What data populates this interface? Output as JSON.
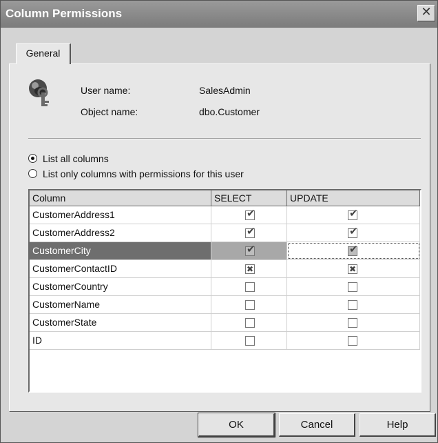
{
  "window": {
    "title": "Column Permissions",
    "close_label": "✕"
  },
  "tabs": [
    {
      "label": "General"
    }
  ],
  "info": {
    "user_name_label": "User name:",
    "user_name_value": "SalesAdmin",
    "object_name_label": "Object name:",
    "object_name_value": "dbo.Customer"
  },
  "options": {
    "list_all": "List all columns",
    "list_only": "List only columns with permissions for this user",
    "selected": "list_all"
  },
  "grid": {
    "columns": [
      "Column",
      "SELECT",
      "UPDATE"
    ],
    "rows": [
      {
        "name": "CustomerAddress1",
        "select": "grant",
        "update": "grant"
      },
      {
        "name": "CustomerAddress2",
        "select": "grant",
        "update": "grant"
      },
      {
        "name": "CustomerCity",
        "select": "grant",
        "update": "grant",
        "selected": true
      },
      {
        "name": "CustomerContactID",
        "select": "deny",
        "update": "deny"
      },
      {
        "name": "CustomerCountry",
        "select": "none",
        "update": "none"
      },
      {
        "name": "CustomerName",
        "select": "none",
        "update": "none"
      },
      {
        "name": "CustomerState",
        "select": "none",
        "update": "none"
      },
      {
        "name": "ID",
        "select": "none",
        "update": "none"
      }
    ]
  },
  "buttons": {
    "ok": "OK",
    "cancel": "Cancel",
    "help": "Help"
  }
}
